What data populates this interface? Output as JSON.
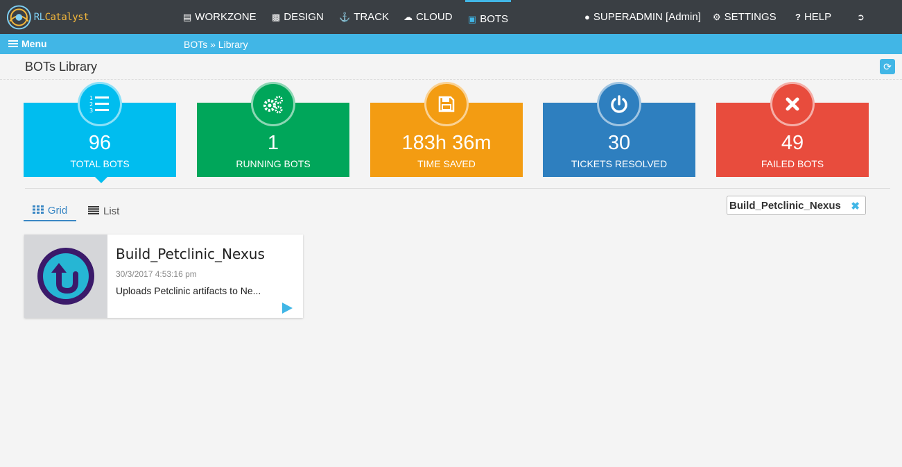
{
  "app": {
    "logo_text_prefix": "RL",
    "logo_text_suffix": "Catalyst"
  },
  "nav": {
    "items": [
      {
        "label": "WORKZONE",
        "icon": "workzone-icon"
      },
      {
        "label": "DESIGN",
        "icon": "design-icon"
      },
      {
        "label": "TRACK",
        "icon": "anchor-icon"
      },
      {
        "label": "CLOUD",
        "icon": "cloud-icon"
      },
      {
        "label": "BOTS",
        "icon": "bots-icon",
        "active": true
      }
    ],
    "user": "SUPERADMIN [Admin]",
    "settings": "SETTINGS",
    "help": "HELP"
  },
  "subbar": {
    "menu_label": "Menu",
    "breadcrumb": "BOTs » Library"
  },
  "page": {
    "title": "BOTs Library"
  },
  "stats": [
    {
      "value": "96",
      "label": "TOTAL BOTS",
      "color": "#00bdef",
      "icon": "numbered-list-icon"
    },
    {
      "value": "1",
      "label": "RUNNING BOTS",
      "color": "#00a65a",
      "icon": "gears-icon"
    },
    {
      "value": "183h 36m",
      "label": "TIME SAVED",
      "color": "#f39c12",
      "icon": "floppy-disk-icon"
    },
    {
      "value": "30",
      "label": "TICKETS RESOLVED",
      "color": "#2e7fbf",
      "icon": "power-icon"
    },
    {
      "value": "49",
      "label": "FAILED BOTS",
      "color": "#e84c3d",
      "icon": "close-icon"
    }
  ],
  "view_tabs": {
    "grid": "Grid",
    "list": "List"
  },
  "filter": {
    "value": "Build_Petclinic_Nexus"
  },
  "bots": [
    {
      "name": "Build_Petclinic_Nexus",
      "date": "30/3/2017 4:53:16 pm",
      "description": "Uploads Petclinic artifacts to Ne..."
    }
  ],
  "colors": {
    "topbar": "#3a3f44",
    "accent": "#41b6e6"
  }
}
